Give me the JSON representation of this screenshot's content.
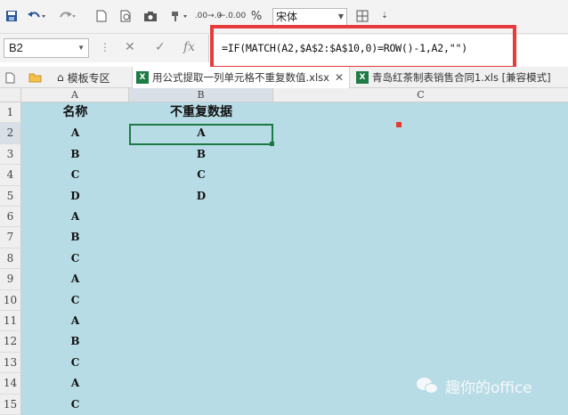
{
  "toolbar": {
    "icons": [
      "save-icon",
      "undo-icon",
      "redo-icon",
      "new-icon",
      "print-preview-icon",
      "camera-icon",
      "format-painter-icon",
      "increase-decimal-icon",
      "decrease-decimal-icon",
      "percent-icon",
      "borders-icon"
    ],
    "increase_decimal": ".00→.0",
    "decrease_decimal": "←.0.00",
    "percent_label": "%",
    "font_name": "宋体"
  },
  "formula_bar": {
    "name_box": "B2",
    "formula": "=IF(MATCH(A2,$A$2:$A$10,0)=ROW()-1,A2,\"\")",
    "highlight_color": "#e83b3b"
  },
  "tabs": [
    {
      "label": "模板专区",
      "icon": "home-icon"
    },
    {
      "label": "用公式提取一列单元格不重复数值.xlsx",
      "icon": "excel-icon",
      "active": true
    },
    {
      "label": "青岛红茶制表销售合同1.xls [兼容模式]",
      "icon": "excel-icon"
    }
  ],
  "columns": [
    "A",
    "B",
    "C"
  ],
  "rows": [
    "1",
    "2",
    "3",
    "4",
    "5",
    "6",
    "7",
    "8",
    "9",
    "10",
    "11",
    "12",
    "13",
    "14",
    "15"
  ],
  "colA": [
    "名称",
    "A",
    "B",
    "C",
    "D",
    "A",
    "B",
    "C",
    "A",
    "C",
    "A",
    "B",
    "C",
    "A",
    "C"
  ],
  "colB": [
    "不重复数据",
    "A",
    "B",
    "C",
    "D",
    "",
    "",
    "",
    "",
    "",
    "",
    "",
    "",
    "",
    ""
  ],
  "selected_cell": "B2",
  "colors": {
    "sheet_bg": "#b8dce6",
    "selection": "#1d7a44"
  },
  "watermark": "趣你的office"
}
